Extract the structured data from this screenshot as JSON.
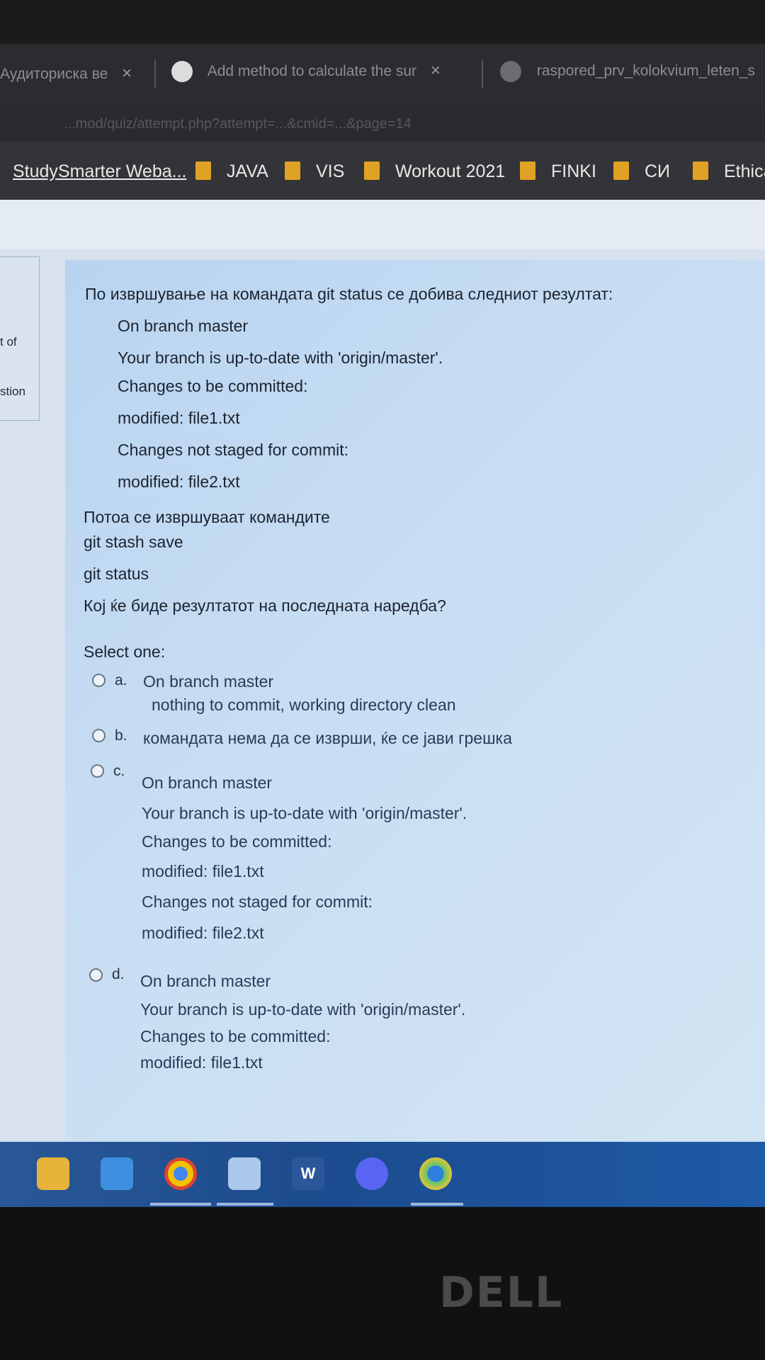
{
  "browser": {
    "tabs": [
      {
        "title": "Аудиториска ве",
        "close": "×"
      },
      {
        "title": "Add method to calculate the sur",
        "close": "×"
      },
      {
        "title": "raspored_prv_kolokvium_leten_s"
      }
    ],
    "address": "...mod/quiz/attempt.php?attempt=...&cmid=...&page=14",
    "bookmarks": [
      "StudySmarter Weba...",
      "JAVA",
      "VIS",
      "Workout 2021",
      "FINKI",
      "СИ",
      "Ethica"
    ]
  },
  "sidebar": {
    "fragment_1": "t of",
    "fragment_2": "stion"
  },
  "question": {
    "intro": "По извршување на командата git status се добива следниот резултат:",
    "status_lines": [
      "On branch master",
      "Your branch is up-to-date with 'origin/master'.",
      "Changes to be committed:",
      "modified: file1.txt",
      "Changes not staged for commit:",
      "modified: file2.txt"
    ],
    "then_text": "Потоа се извршуваат командите",
    "commands": [
      "git stash save",
      "git status"
    ],
    "prompt": "Кој ќе биде резултатот на последната наредба?",
    "select_label": "Select one:",
    "options": {
      "a": {
        "letter": "a.",
        "lines": [
          "On branch master",
          "nothing to commit, working directory clean"
        ]
      },
      "b": {
        "letter": "b.",
        "lines": [
          "командата нема да се изврши, ќе се јави грешка"
        ]
      },
      "c": {
        "letter": "c.",
        "lines": [
          "On branch master",
          "Your branch is up-to-date with 'origin/master'.",
          "Changes to be committed:",
          "modified: file1.txt",
          "Changes not staged for commit:",
          "modified: file2.txt"
        ]
      },
      "d": {
        "letter": "d.",
        "lines": [
          "On branch master",
          "Your branch is up-to-date with 'origin/master'.",
          "Changes to be committed:",
          "modified: file1.txt"
        ]
      }
    }
  },
  "taskbar": {
    "apps": [
      "file-explorer-icon",
      "mail-icon",
      "chrome-icon",
      "notepad-icon",
      "word-icon",
      "discord-icon",
      "browser-icon"
    ],
    "word_label": "W"
  },
  "device": {
    "brand": "DELL"
  }
}
